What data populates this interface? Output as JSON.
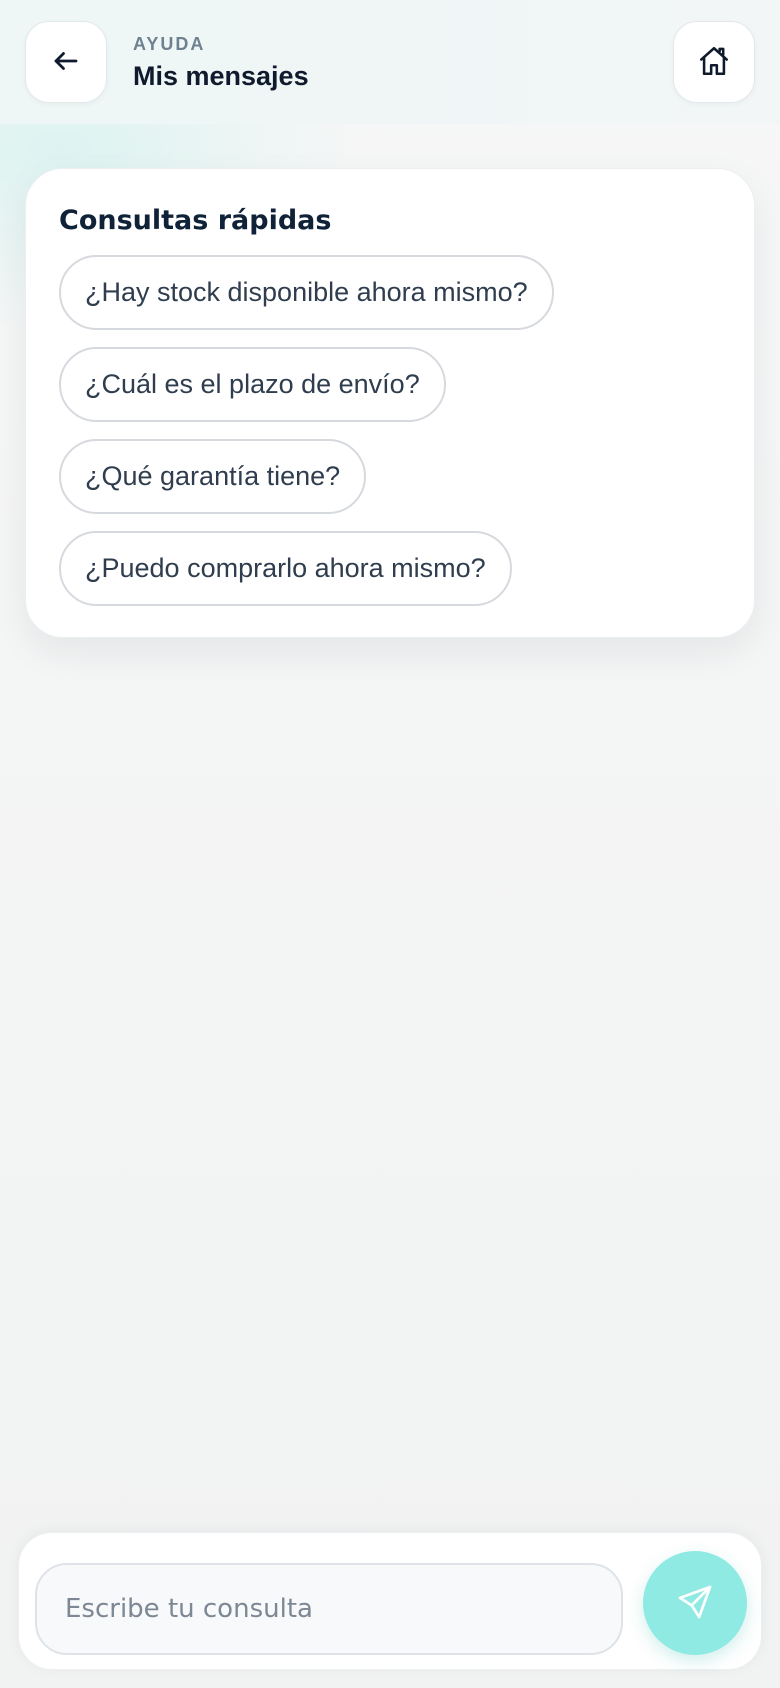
{
  "header": {
    "back_icon": "arrow-left-icon",
    "home_icon": "home-icon",
    "eyebrow": "AYUDA",
    "title": "Mis mensajes"
  },
  "quick_queries": {
    "title": "Consultas rápidas",
    "items": [
      "¿Hay stock disponible ahora mismo?",
      "¿Cuál es el plazo de envío?",
      "¿Qué garantía tiene?",
      "¿Puedo comprarlo ahora mismo?"
    ]
  },
  "composer": {
    "placeholder": "Escribe tu consulta",
    "value": "",
    "send_icon": "send-icon",
    "send_color": "#8feae3"
  }
}
